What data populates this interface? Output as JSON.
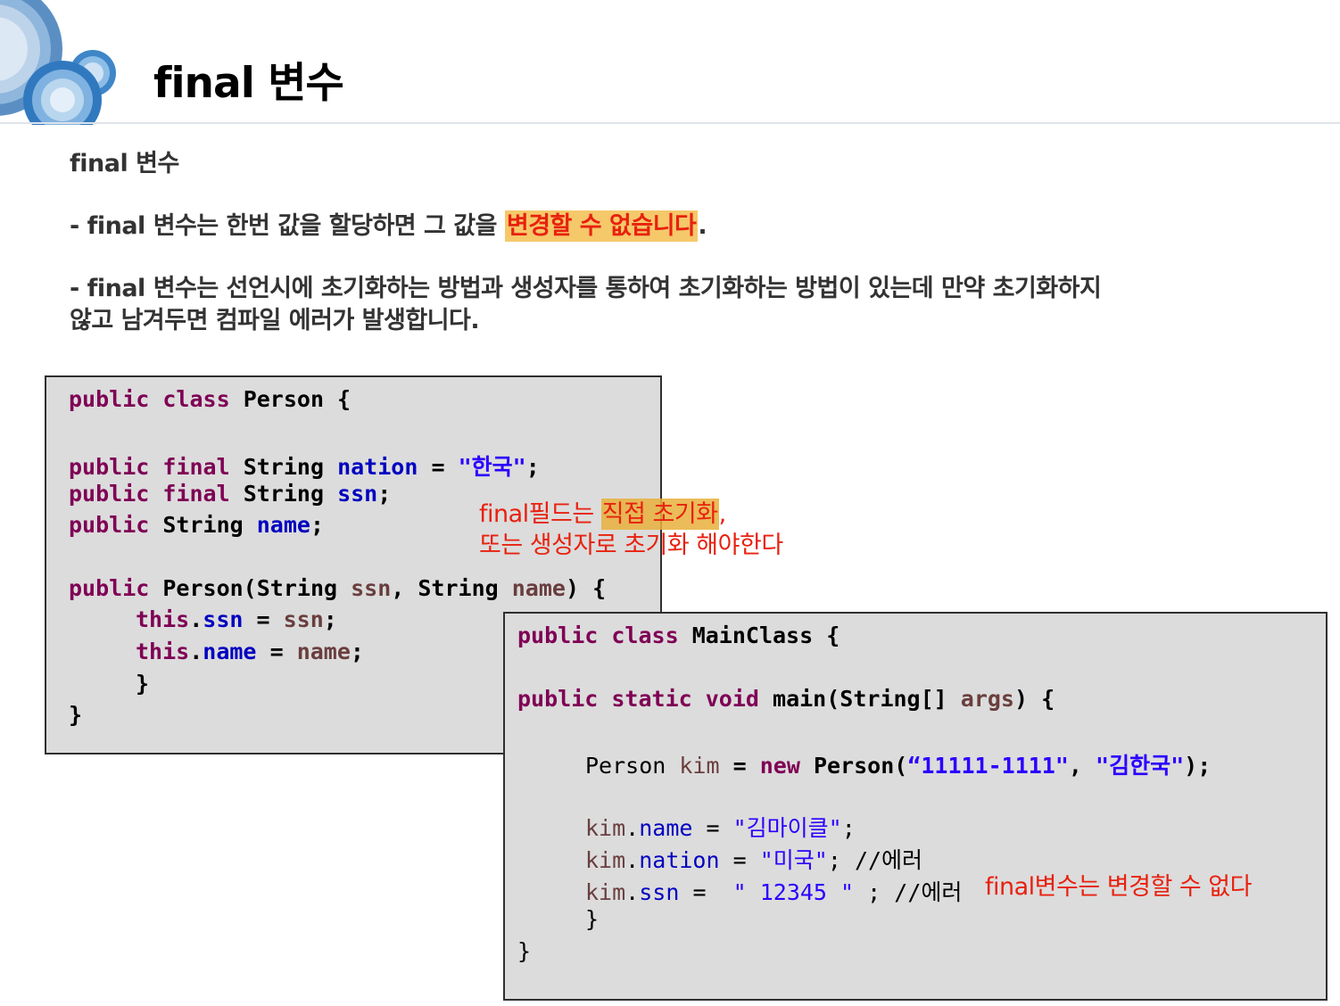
{
  "title": "final 변수",
  "body": {
    "heading": "final 변수",
    "bullet1_prefix": "- final 변수는 한번 값을 할당하면 그 값을 ",
    "bullet1_highlight": "변경할 수 없습니다",
    "bullet1_suffix": ".",
    "bullet2_line1": "- final 변수는 선언시에 초기화하는 방법과 생성자를 통하여 초기화하는 방법이 있는데 만약 초기화하지",
    "bullet2_line2": "않고 남겨두면 컴파일 에러가 발생합니다."
  },
  "person_code": {
    "l1_kw1": "public",
    "l1_kw2": "class",
    "l1_rest": "Person {",
    "l2_kw1": "public",
    "l2_kw2": "final",
    "l2_type": "String",
    "l2_field": "nation",
    "l2_eq": "=",
    "l2_str": "\"한국\"",
    "l2_end": ";",
    "l3_kw1": "public",
    "l3_kw2": "final",
    "l3_type": "String",
    "l3_field": "ssn",
    "l3_end": ";",
    "l4_kw1": "public",
    "l4_type": "String",
    "l4_field": "name",
    "l4_end": ";",
    "l5_kw1": "public",
    "l5_a": "Person(String",
    "l5_p1": "ssn",
    "l5_b": ", String",
    "l5_p2": "name",
    "l5_c": ") {",
    "l6_this": "this",
    "l6_dot": ".",
    "l6_field": "ssn",
    "l6_eq": "=",
    "l6_var": "ssn",
    "l6_end": ";",
    "l7_this": "this",
    "l7_dot": ".",
    "l7_field": "name",
    "l7_eq": "=",
    "l7_var": "name",
    "l7_end": ";",
    "l8": "}",
    "l9": "}"
  },
  "note1": {
    "line1_prefix": "final필드는 ",
    "line1_highlight": "직접 초기화",
    "line1_suffix": ",",
    "line2": "또는 생성자로 초기화 해야한다"
  },
  "main_code": {
    "l1_kw1": "public",
    "l1_kw2": "class",
    "l1_rest": "MainClass {",
    "l2_kw1": "public",
    "l2_kw2": "static",
    "l2_kw3": "void",
    "l2_a": "main(String[]",
    "l2_var": "args",
    "l2_b": ") {",
    "l3_type": "Person",
    "l3_var": "kim",
    "l3_eq": "=",
    "l3_new": "new",
    "l3_a": "Person(",
    "l3_str1": "“11111-1111\"",
    "l3_comma": ",",
    "l3_str2": "\"김한국\"",
    "l3_b": ");",
    "l4_var": "kim",
    "l4_dot": ".",
    "l4_field": "name",
    "l4_eq": "=",
    "l4_str": "\"김마이클\"",
    "l4_end": ";",
    "l5_var": "kim",
    "l5_dot": ".",
    "l5_field": "nation",
    "l5_eq": "=",
    "l5_str": "\"미국\"",
    "l5_end": ";",
    "l5_comment": "//에러",
    "l6_var": "kim",
    "l6_dot": ".",
    "l6_field": "ssn",
    "l6_eq": "=",
    "l6_str": "\" 12345 \"",
    "l6_end": ";",
    "l6_comment": "//에러",
    "l7": "}",
    "l8": "}"
  },
  "note2": "final변수는 변경할 수 없다",
  "colors": {
    "keyword": "#7f0055",
    "field": "#0000c0",
    "variable": "#6a3e3e",
    "string": "#2a00ff",
    "note_red": "#e8210f",
    "highlight": "#f5c86a",
    "code_bg": "#dcdcdc"
  },
  "icons": {
    "logo": "concentric-circles-logo"
  }
}
